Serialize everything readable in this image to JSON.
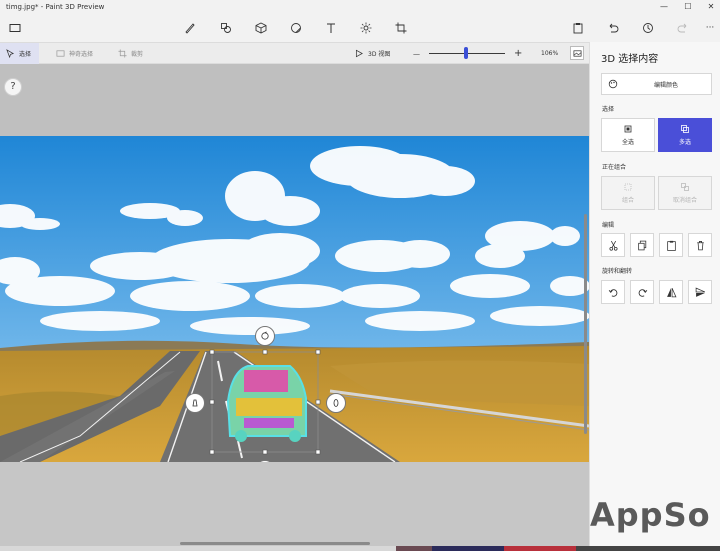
{
  "window": {
    "title": "timg.jpg* - Paint 3D Preview",
    "controls": [
      "minimize",
      "maximize",
      "close"
    ]
  },
  "toolbar": {
    "left_icon": "menu-icon",
    "tools": [
      "brush-icon",
      "2d-shapes-icon",
      "3d-objects-icon",
      "stickers-icon",
      "text-icon",
      "effects-icon",
      "crop-icon"
    ],
    "right_tools": [
      "paste-icon",
      "undo-icon",
      "history-icon",
      "redo-icon",
      "more-icon"
    ],
    "more_label": "···"
  },
  "subbar": {
    "select_label": "选择",
    "magic_select_label": "神奇选择",
    "crop_label": "裁剪",
    "view3d_label": "3D 视图",
    "zoom_minus": "—",
    "zoom_plus": "+",
    "zoom_percent": "106%",
    "zoom_level": 0.49
  },
  "canvas": {
    "help": "?"
  },
  "panel": {
    "title": "3D 选择内容",
    "edit_color_label": "编辑颜色",
    "select_section": "选择",
    "select_all_label": "全选",
    "multi_select_label": "多选",
    "group_section": "正在组合",
    "group_label": "组合",
    "ungroup_label": "取消组合",
    "edit_section": "编辑",
    "edit_icons": [
      "cut-icon",
      "copy-icon",
      "paste-icon",
      "delete-icon"
    ],
    "rotate_section": "旋转和翻转",
    "rotate_icons": [
      "rotate-left-icon",
      "rotate-right-icon",
      "flip-horizontal-icon",
      "flip-vertical-icon"
    ]
  },
  "colors": {
    "accent": "#4a4fd8",
    "sky": "#2f8fd8",
    "road": "#6e6e6e",
    "grass": "#c89a34"
  },
  "watermark": "AppSo"
}
